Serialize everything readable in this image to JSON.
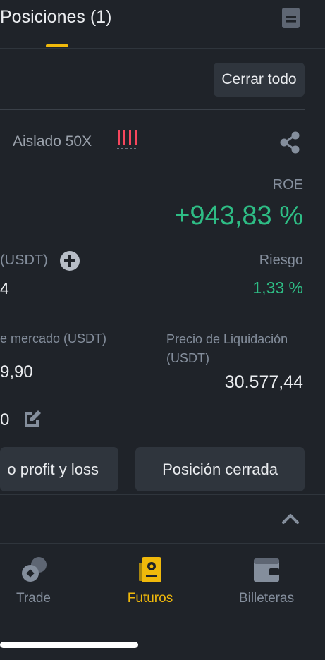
{
  "header": {
    "tab_title": "Posiciones (1)",
    "doc_icon": "document-icon"
  },
  "actions": {
    "close_all_label": "Cerrar todo"
  },
  "position": {
    "margin_mode": "Aislado 50X",
    "roe_label": "ROE",
    "roe_value": "+943,83 %",
    "size_label": "(USDT)",
    "size_value": "4",
    "risk_label": "Riesgo",
    "risk_value": "1,33 %",
    "mark_price_label": "e mercado (USDT)",
    "mark_price_value": "9,90",
    "liq_price_label": "Precio de Liquidación (USDT)",
    "liq_price_value": "30.577,44",
    "margin_value": "0"
  },
  "buttons": {
    "tpsl_label": "o profit y loss",
    "closed_position_label": "Posición cerrada"
  },
  "nav": {
    "items": [
      {
        "label": "Trade",
        "icon": "trade-icon",
        "active": false
      },
      {
        "label": "Futuros",
        "icon": "futures-icon",
        "active": true
      },
      {
        "label": "Billeteras",
        "icon": "wallet-icon",
        "active": false
      }
    ]
  },
  "colors": {
    "background": "#1f2329",
    "accent": "#f0b90b",
    "positive": "#2ebd85",
    "negative": "#f6465d",
    "muted": "#848e9c",
    "surface": "#2f353d"
  }
}
